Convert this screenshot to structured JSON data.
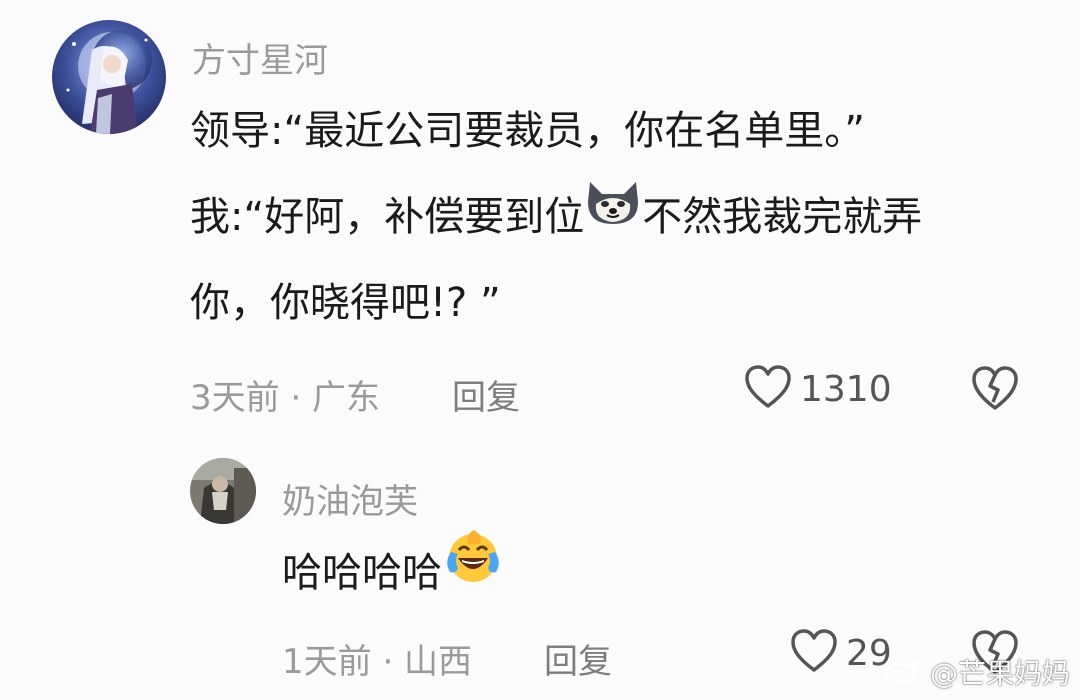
{
  "comment": {
    "username": "方寸星河",
    "lines": [
      "领导:“最近公司要裁员，你在名单里。”",
      "我:“好阿，补偿要到位",
      "不然我裁完就弄",
      "你，你晓得吧!? ”"
    ],
    "time_location": "3天前 · 广东",
    "reply_label": "回复",
    "likes": "1310",
    "inline_emoji": "doge-icon"
  },
  "reply": {
    "username": "奶油泡芙",
    "text": "哈哈哈哈",
    "inline_emoji": "laughing-crying-icon",
    "time_location": "1天前 · 山西",
    "reply_label": "回复",
    "likes": "29"
  },
  "watermark": "@芒果妈妈",
  "colors": {
    "background": "#fbfbfb",
    "text": "#1b1b1b",
    "muted": "#9a9a9a"
  }
}
